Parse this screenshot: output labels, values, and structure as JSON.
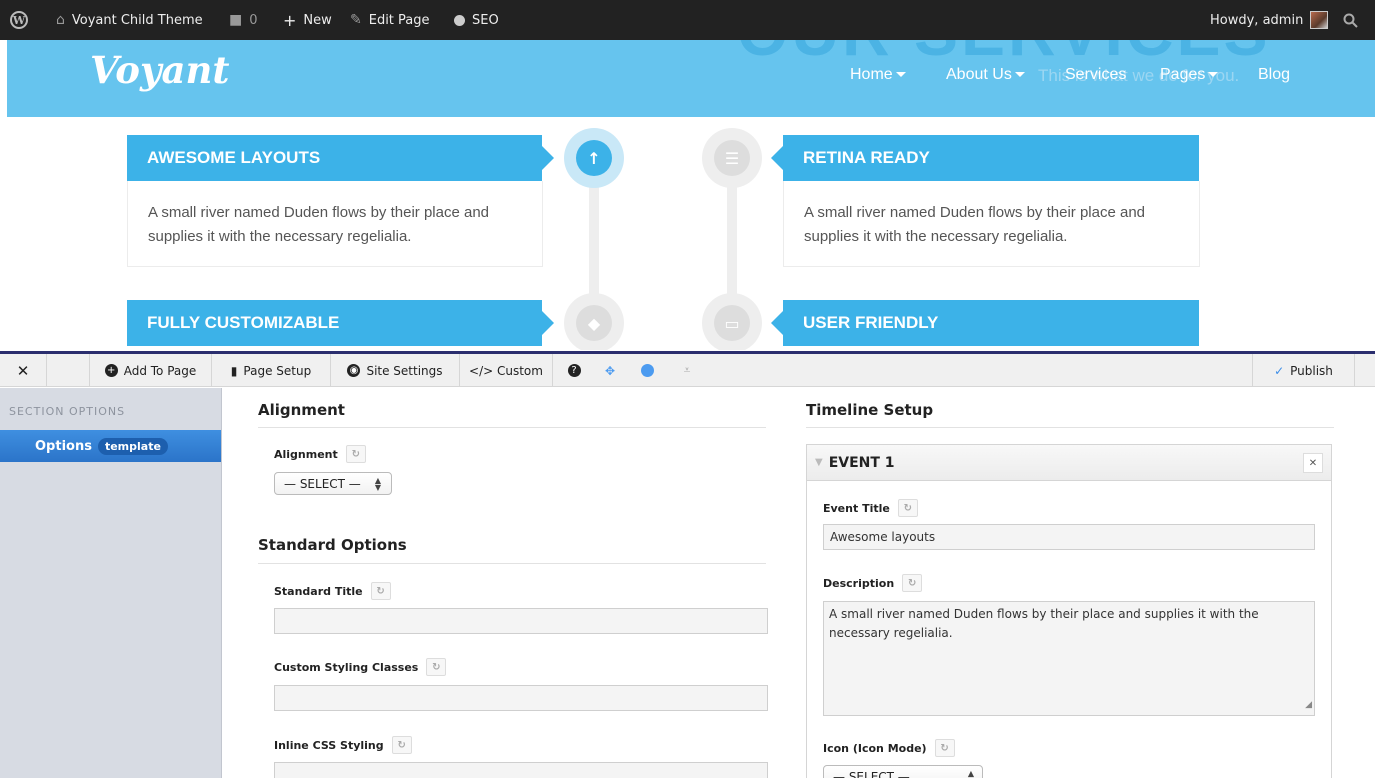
{
  "adminbar": {
    "site_name": "Voyant Child Theme",
    "comments_count": "0",
    "new_label": "New",
    "edit_label": "Edit Page",
    "seo_label": "SEO",
    "howdy": "Howdy, admin"
  },
  "site": {
    "logo": "Voyant",
    "ghost_title": "OUR SERVICES",
    "ghost_subtitle": "This is what we do for you.",
    "nav": [
      {
        "label": "Home"
      },
      {
        "label": "About Us"
      },
      {
        "label": "Services"
      },
      {
        "label": "Pages"
      },
      {
        "label": "Blog"
      }
    ]
  },
  "timeline": {
    "events": [
      {
        "title": "AWESOME LAYOUTS",
        "description": "A small river named Duden flows by their place and supplies it with the necessary regelialia."
      },
      {
        "title": "RETINA READY",
        "description": "A small river named Duden flows by their place and supplies it with the necessary regelialia."
      },
      {
        "title": "FULLY CUSTOMIZABLE"
      },
      {
        "title": "USER FRIENDLY"
      }
    ]
  },
  "toolbar": {
    "add_to_page": "Add To Page",
    "page_setup": "Page Setup",
    "site_settings": "Site Settings",
    "custom": "</> Custom",
    "publish": "Publish"
  },
  "left_panel": {
    "heading": "SECTION OPTIONS",
    "item_label": "Options",
    "item_badge": "template"
  },
  "options": {
    "alignment_section": "Alignment",
    "alignment_label": "Alignment",
    "alignment_value": "— SELECT —",
    "standard_section": "Standard Options",
    "standard_title_label": "Standard Title",
    "standard_title_value": "",
    "custom_classes_label": "Custom Styling Classes",
    "custom_classes_value": "",
    "inline_css_label": "Inline CSS Styling",
    "inline_css_value": ""
  },
  "timeline_setup": {
    "section": "Timeline Setup",
    "event_name": "EVENT 1",
    "event_title_label": "Event Title",
    "event_title_value": "Awesome layouts",
    "description_label": "Description",
    "description_value": "A small river named Duden flows by their place and supplies it with the necessary regelialia.",
    "icon_label": "Icon (Icon Mode)",
    "icon_value": "— SELECT —"
  },
  "colors": {
    "adminbar_bg": "#222222",
    "header_bg": "#66c4ee",
    "accent_blue": "#3cb2e8",
    "toolbar_border": "#2b2e6e",
    "panel_active": "#2b74c9"
  }
}
